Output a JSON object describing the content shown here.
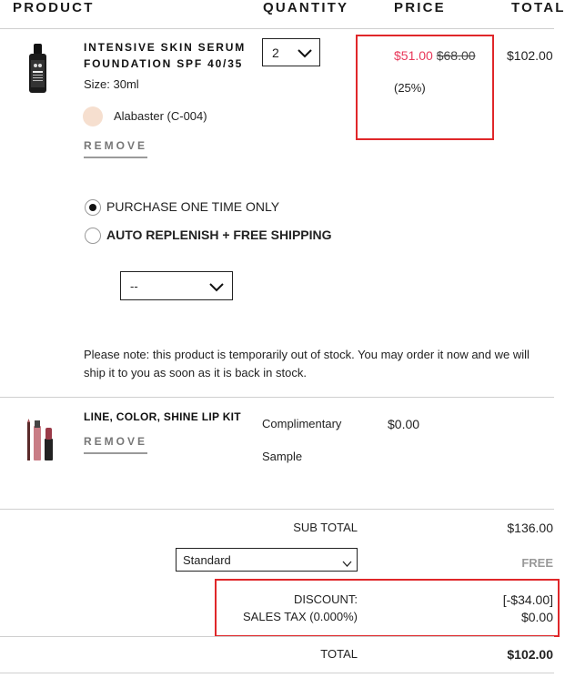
{
  "headers": {
    "product": "PRODUCT",
    "quantity": "QUANTITY",
    "price": "PRICE",
    "total": "TOTAL"
  },
  "item1": {
    "name_line1": "INTENSIVE SKIN SERUM",
    "name_line2": "FOUNDATION SPF 40/35",
    "size": "Size: 30ml",
    "shade": "Alabaster (C-004)",
    "shade_color": "#f6dfcf",
    "remove": "REMOVE",
    "quantity": "2",
    "sale_price": "$51.00",
    "original_price": "$68.00",
    "discount_pct": "(25%)",
    "total": "$102.00",
    "purchase_once": "PURCHASE ONE TIME ONLY",
    "auto_replenish": "AUTO REPLENISH + FREE SHIPPING",
    "replenish_select": "--",
    "note": "Please note: this product is temporarily out of stock. You may order it now and we will ship it to you as soon as it is back in stock."
  },
  "item2": {
    "name": "LINE, COLOR, SHINE LIP KIT",
    "remove": "REMOVE",
    "type_line1": "Complimentary",
    "type_line2": "Sample",
    "price": "$0.00"
  },
  "summary": {
    "subtotal_label": "SUB TOTAL",
    "subtotal": "$136.00",
    "shipping_method": "Standard",
    "shipping_cost": "FREE",
    "discount_label": "DISCOUNT:",
    "discount": "[-$34.00]",
    "tax_label": "SALES TAX (0.000%)",
    "tax": "$0.00",
    "total_label": "TOTAL",
    "total": "$102.00"
  },
  "colors": {
    "sale_red": "#e8385a",
    "highlight_red": "#e0272a"
  }
}
